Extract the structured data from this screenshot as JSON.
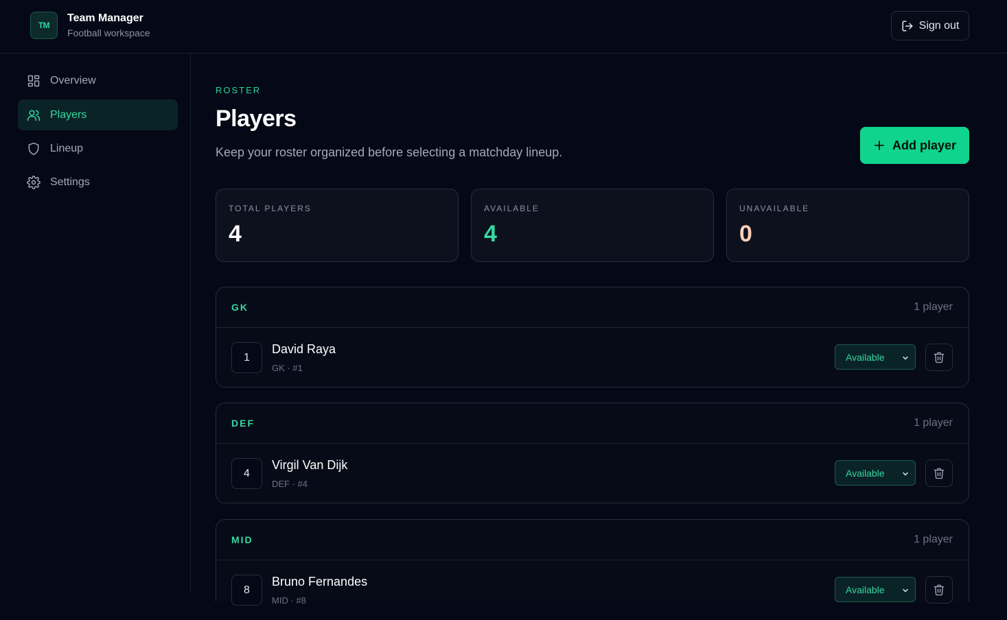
{
  "header": {
    "logo_text": "TM",
    "title": "Team Manager",
    "subtitle": "Football workspace",
    "sign_out_label": "Sign out"
  },
  "sidebar": {
    "items": [
      {
        "label": "Overview",
        "icon": "grid-icon",
        "active": false
      },
      {
        "label": "Players",
        "icon": "users-icon",
        "active": true
      },
      {
        "label": "Lineup",
        "icon": "shield-icon",
        "active": false
      },
      {
        "label": "Settings",
        "icon": "gear-icon",
        "active": false
      }
    ]
  },
  "main": {
    "eyebrow": "ROSTER",
    "title": "Players",
    "description": "Keep your roster organized before selecting a matchday lineup.",
    "add_button_label": "Add player"
  },
  "stats": [
    {
      "label": "TOTAL PLAYERS",
      "value": "4",
      "color": "#ffffff"
    },
    {
      "label": "AVAILABLE",
      "value": "4",
      "color": "#36d9a0"
    },
    {
      "label": "UNAVAILABLE",
      "value": "0",
      "color": "#fbcfb8"
    }
  ],
  "groups": [
    {
      "position": "GK",
      "count": "1 player",
      "player": {
        "number": "1",
        "name": "David Raya",
        "meta": "GK · #1",
        "status": "Available"
      }
    },
    {
      "position": "DEF",
      "count": "1 player",
      "player": {
        "number": "4",
        "name": "Virgil Van Dijk",
        "meta": "DEF · #4",
        "status": "Available"
      }
    },
    {
      "position": "MID",
      "count": "1 player",
      "player": {
        "number": "8",
        "name": "Bruno Fernandes",
        "meta": "MID · #8",
        "status": "Available"
      }
    }
  ],
  "colors": {
    "accent": "#10d48e",
    "background": "#050816"
  }
}
